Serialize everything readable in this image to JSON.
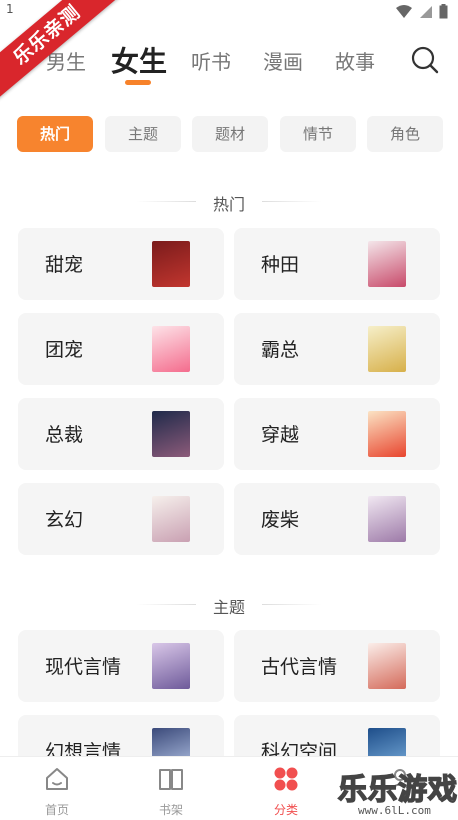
{
  "status_bar": {
    "time": "1"
  },
  "watermark": {
    "ribbon_text": "乐乐亲测",
    "corner_text": "乐乐游戏",
    "corner_url": "www.6lL.com"
  },
  "top_tabs": [
    {
      "label": "男生",
      "active": false
    },
    {
      "label": "女生",
      "active": true
    },
    {
      "label": "听书",
      "active": false
    },
    {
      "label": "漫画",
      "active": false
    },
    {
      "label": "故事",
      "active": false
    }
  ],
  "chips": [
    {
      "label": "热门",
      "active": true
    },
    {
      "label": "主题",
      "active": false
    },
    {
      "label": "题材",
      "active": false
    },
    {
      "label": "情节",
      "active": false
    },
    {
      "label": "角色",
      "active": false
    }
  ],
  "sections": [
    {
      "title": "热门",
      "cards": [
        {
          "label": "甜宠",
          "cover_colors": [
            "#7a1b1b",
            "#c2362f"
          ]
        },
        {
          "label": "种田",
          "cover_colors": [
            "#f4e6ea",
            "#c84a6a"
          ]
        },
        {
          "label": "团宠",
          "cover_colors": [
            "#fde3e8",
            "#f46c8d"
          ]
        },
        {
          "label": "霸总",
          "cover_colors": [
            "#f6efc9",
            "#d7b04a"
          ]
        },
        {
          "label": "总裁",
          "cover_colors": [
            "#1f2a4a",
            "#8d5b7a"
          ]
        },
        {
          "label": "穿越",
          "cover_colors": [
            "#fbe3c4",
            "#e8452e"
          ]
        },
        {
          "label": "玄幻",
          "cover_colors": [
            "#f6f0ec",
            "#c9a0b2"
          ]
        },
        {
          "label": "废柴",
          "cover_colors": [
            "#f1e8f2",
            "#9d7aa8"
          ]
        }
      ]
    },
    {
      "title": "主题",
      "cards": [
        {
          "label": "现代言情",
          "cover_colors": [
            "#d9c7e8",
            "#6e5a9a"
          ]
        },
        {
          "label": "古代言情",
          "cover_colors": [
            "#fbeeea",
            "#d46a5a"
          ]
        },
        {
          "label": "幻想言情",
          "cover_colors": [
            "#3b4a7a",
            "#b9c9ea"
          ]
        },
        {
          "label": "科幻空间",
          "cover_colors": [
            "#1e4e8a",
            "#7fb3e0"
          ]
        }
      ]
    }
  ],
  "bottom_nav": [
    {
      "label": "首页",
      "icon": "home-icon",
      "active": false
    },
    {
      "label": "书架",
      "icon": "bookshelf-icon",
      "active": false
    },
    {
      "label": "分类",
      "icon": "category-icon",
      "active": true
    },
    {
      "label": "",
      "icon": "profile-icon",
      "active": false
    }
  ],
  "colors": {
    "accent": "#f7842e",
    "nav_active": "#f14f4f",
    "watermark_red": "#d9262c"
  }
}
